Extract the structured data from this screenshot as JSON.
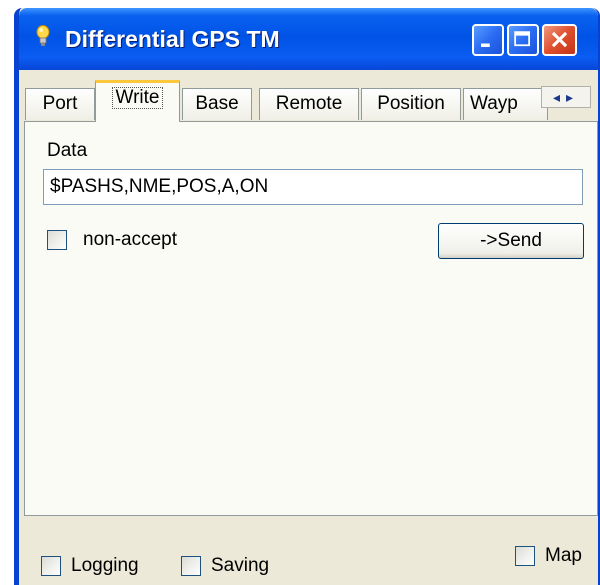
{
  "window": {
    "title": "Differential GPS TM",
    "controls": {
      "minimize": "minimize-icon",
      "maximize": "maximize-icon",
      "close": "close-icon"
    }
  },
  "tabs": [
    {
      "label": "Port",
      "active": false
    },
    {
      "label": "Write",
      "active": true
    },
    {
      "label": "Base",
      "active": false
    },
    {
      "label": "Remote",
      "active": false
    },
    {
      "label": "Position",
      "active": false
    },
    {
      "label": "Wayp",
      "active": false
    }
  ],
  "tab_scroll": {
    "left": "◂",
    "right": "▸"
  },
  "write_panel": {
    "data_label": "Data",
    "data_value": "$PASHS,NME,POS,A,ON",
    "non_accept_label": "non-accept",
    "non_accept_checked": false,
    "send_label": "->Send"
  },
  "footer": {
    "logging_label": "Logging",
    "logging_checked": false,
    "saving_label": "Saving",
    "saving_checked": false,
    "map_label": "Map",
    "map_checked": false
  },
  "colors": {
    "title_bar": "#0053e6",
    "window_bg": "#ece9d8",
    "active_tab_accent": "#ffc83c",
    "close_button": "#de4f2c"
  }
}
